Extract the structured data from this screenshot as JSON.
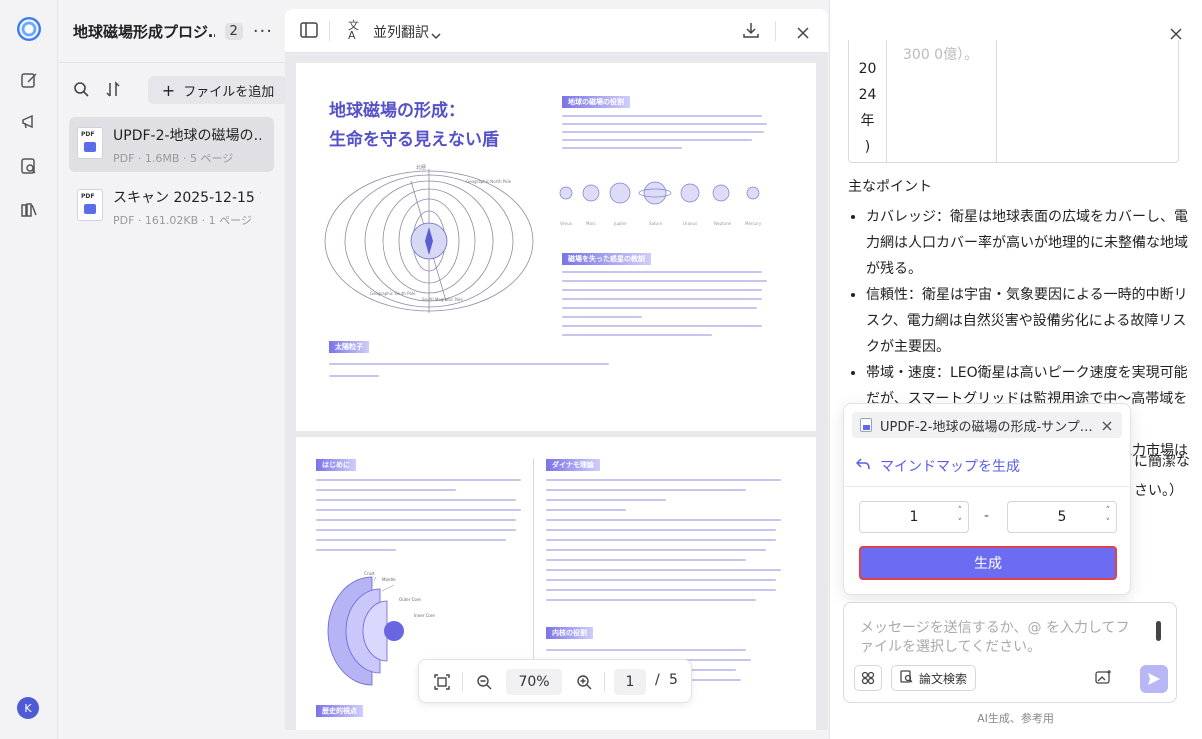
{
  "rail": {
    "avatar_letter": "K"
  },
  "files": {
    "title": "地球磁場形成プロジ…",
    "count": "2",
    "more": "···",
    "add_label": "ファイルを追加",
    "items": [
      {
        "name": "UPDF-2-地球の磁場の…",
        "meta": "PDF · 1.6MB · 5 ページ",
        "icon_text": "PDF"
      },
      {
        "name": "スキャン 2025-12-15 1…",
        "meta": "PDF · 161.02KB · 1 ページ",
        "icon_text": "PDF"
      }
    ]
  },
  "viewer": {
    "mode_label": "並列翻訳",
    "page1": {
      "title_line1": "地球磁場の形成：",
      "title_line2": "生命を守る見えない盾",
      "tag1": "地球の磁場の役割",
      "tag2": "磁場を失った惑星の教訓",
      "tag3": "太陽粒子",
      "diagram_labels": {
        "north": "北極",
        "geo_north": "Geographic North Pole",
        "geo_south": "Geographic South Pole",
        "mag_south": "South Magnetic Pole"
      },
      "planets": [
        "Venus",
        "Mars",
        "Jupiter",
        "Saturn",
        "Uranus",
        "Neptune",
        "Mercury"
      ]
    },
    "page2": {
      "tag1": "はじめに",
      "tag2": "ダイナモ理論",
      "tag3": "内核の役割",
      "tag4": "歴史的視点",
      "layers": [
        "Crust",
        "Mantle",
        "Outer Core",
        "Inner Core"
      ]
    },
    "zoom": {
      "percent": "70%",
      "page": "1",
      "total": "5",
      "slash": "/"
    }
  },
  "chat": {
    "table_col1": [
      "20",
      "24",
      "年",
      ")"
    ],
    "table_col2_fade": "300 0億）。",
    "heading": "主なポイント",
    "bullets": [
      "カバレッジ：衛星は地球表面の広域をカバーし、電力網は人口カバー率が高いが地理的に未整備な地域が残る。",
      "信頼性：衛星は宇宙・気象要因による一時的中断リスク、電力網は自然災害や設備劣化による故障リスクが主要因。",
      "帯域・速度：LEO衛星は高いピーク速度を実現可能だが、スマートグリッドは監視用途で中〜高帯域を提供。",
      "経済規模：衛星通信は数千億ドル規模、電力市場は兆単"
    ],
    "hidden_tail_1": "に簡潔な",
    "hidden_tail_2": "さい。）",
    "popup": {
      "chip": "UPDF-2-地球の磁場の形成-サンプ…",
      "mindmap": "マインドマップを生成",
      "from": "1",
      "dash": "-",
      "to": "5",
      "generate": "生成"
    },
    "input_placeholder": "メッセージを送信するか、@ を入力してファイルを選択してください。",
    "paper_search": "論文検索",
    "footer": "AI生成、参考用"
  }
}
